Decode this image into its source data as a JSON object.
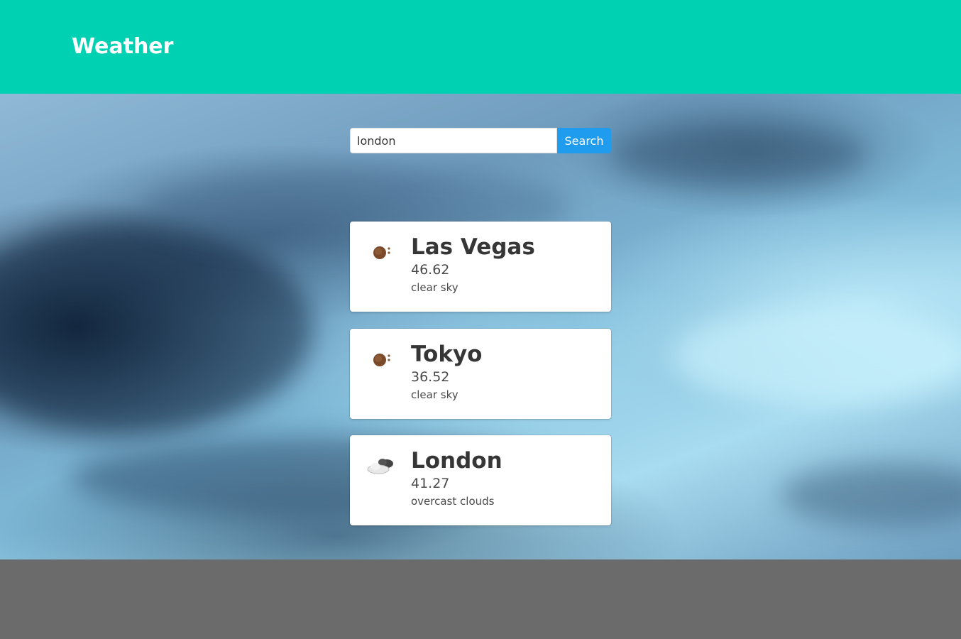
{
  "header": {
    "title": "Weather"
  },
  "search": {
    "value": "london",
    "button_label": "Search"
  },
  "cards": [
    {
      "city": "Las Vegas",
      "temp": "46.62",
      "description": "clear sky",
      "icon": "clear-sky-icon"
    },
    {
      "city": "Tokyo",
      "temp": "36.52",
      "description": "clear sky",
      "icon": "clear-sky-icon"
    },
    {
      "city": "London",
      "temp": "41.27",
      "description": "overcast clouds",
      "icon": "overcast-clouds-icon"
    }
  ],
  "colors": {
    "header_bg": "#00d1b2",
    "button_bg": "#209cee",
    "footer_bg": "#6b6b6b"
  }
}
